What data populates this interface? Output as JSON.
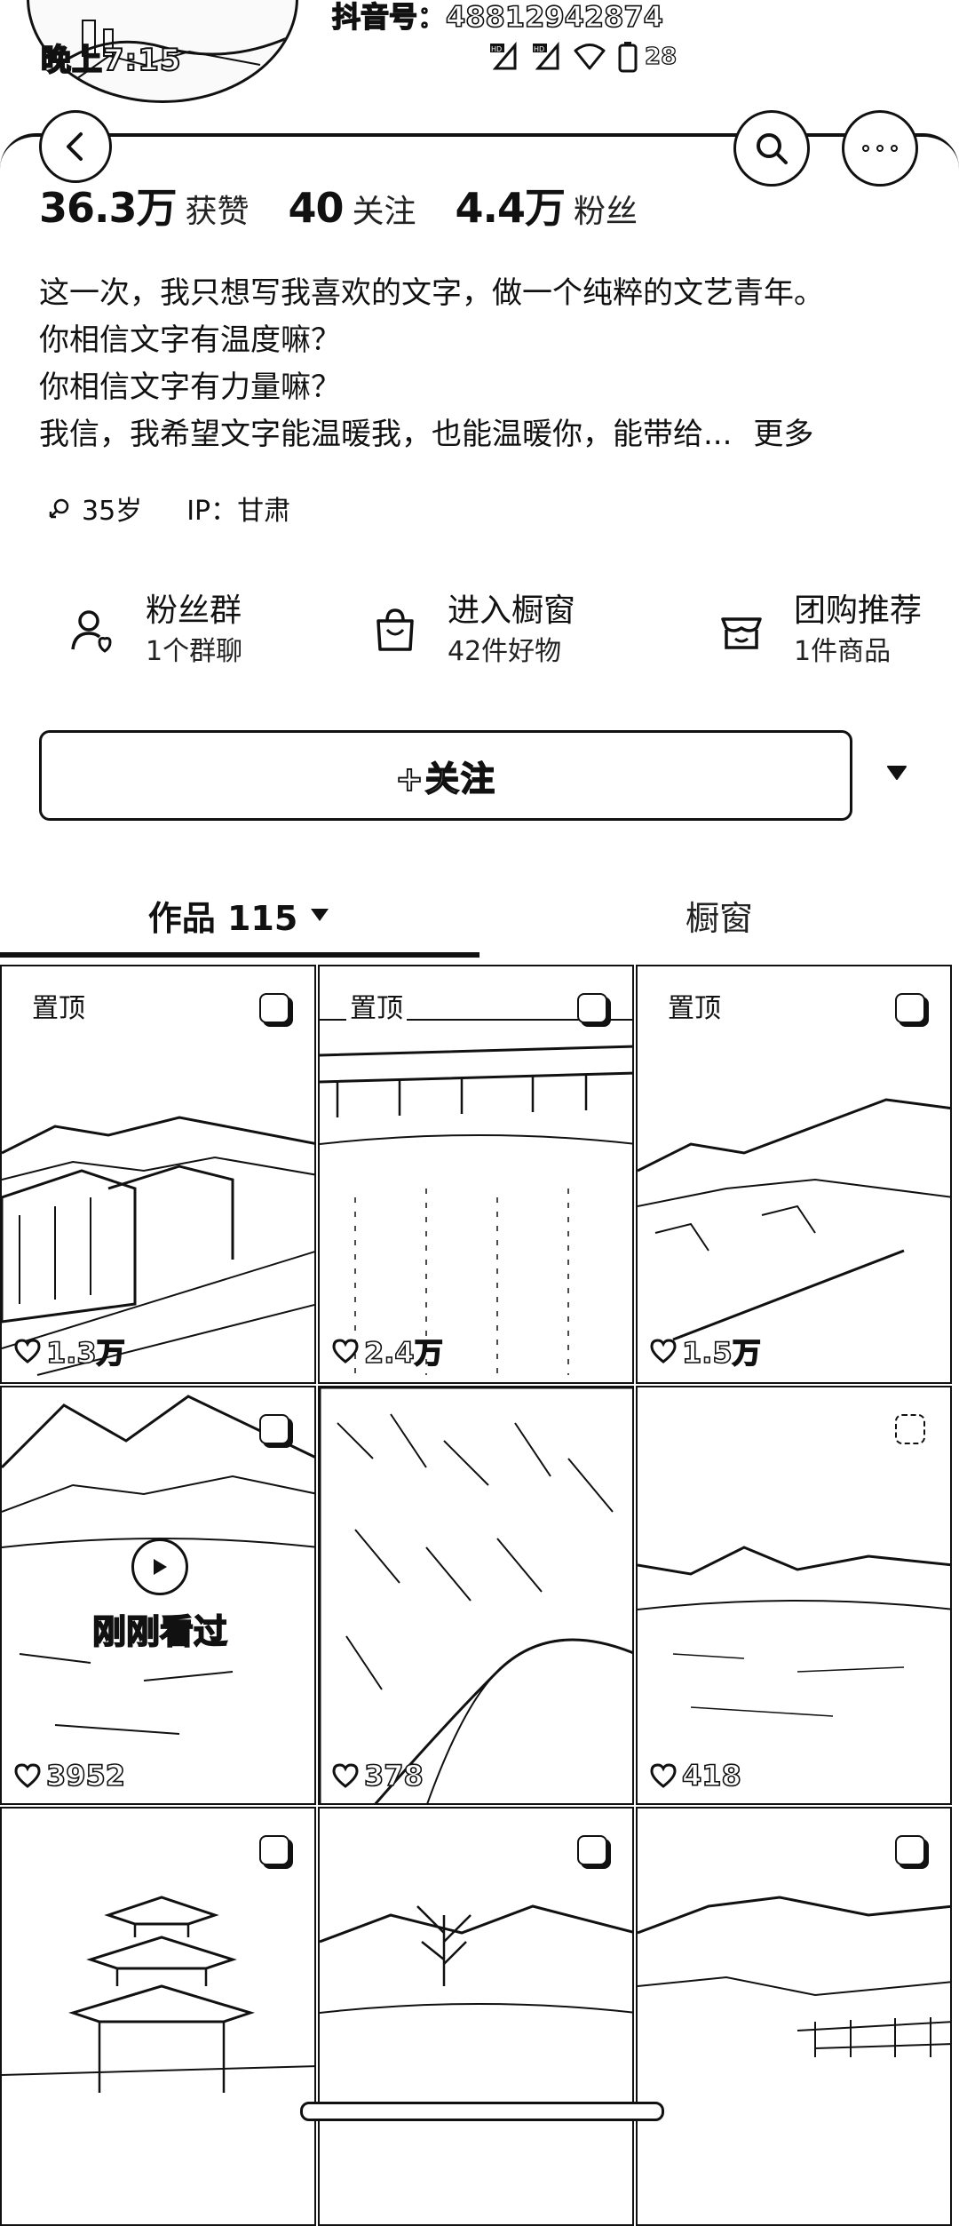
{
  "status_bar": {
    "time": "晚上7:15",
    "douyin_id": "抖音号：48812942874",
    "battery": "28",
    "icons": [
      "hd-signal-icon",
      "hd-signal-icon",
      "wifi-icon",
      "battery-icon"
    ]
  },
  "nav": {
    "back_icon": "back-arrow-icon",
    "search_icon": "search-icon",
    "more_icon": "more-icon"
  },
  "stats": {
    "likes_value": "36.3万",
    "likes_label": "获赞",
    "following_value": "40",
    "following_label": "关注",
    "followers_value": "4.4万",
    "followers_label": "粉丝"
  },
  "bio": {
    "line1": "这一次，我只想写我喜欢的文字，做一个纯粹的文艺青年。",
    "line2": "你相信文字有温度嘛？",
    "line3": "你相信文字有力量嘛？",
    "line4": "我信，我希望文字能温暖我，也能温暖你，能带给...",
    "more": "更多"
  },
  "meta": {
    "age": "35岁",
    "ip": "IP：甘肃"
  },
  "features": [
    {
      "title": "粉丝群",
      "sub": "1个群聊",
      "icon": "fan-group-icon"
    },
    {
      "title": "进入橱窗",
      "sub": "42件好物",
      "icon": "shopping-bag-icon"
    },
    {
      "title": "团购推荐",
      "sub": "1件商品",
      "icon": "group-buy-icon"
    }
  ],
  "follow": {
    "label": "+关注"
  },
  "tabs": {
    "works": "作品 115",
    "showcase": "橱窗"
  },
  "grid": [
    {
      "pinned": "置顶",
      "likes": "1.3万"
    },
    {
      "pinned": "置顶",
      "likes": "2.4万"
    },
    {
      "pinned": "置顶",
      "likes": "1.5万"
    },
    {
      "likes": "3952",
      "watched": "刚刚看过"
    },
    {
      "likes": "378"
    },
    {
      "likes": "418"
    },
    {},
    {},
    {}
  ]
}
